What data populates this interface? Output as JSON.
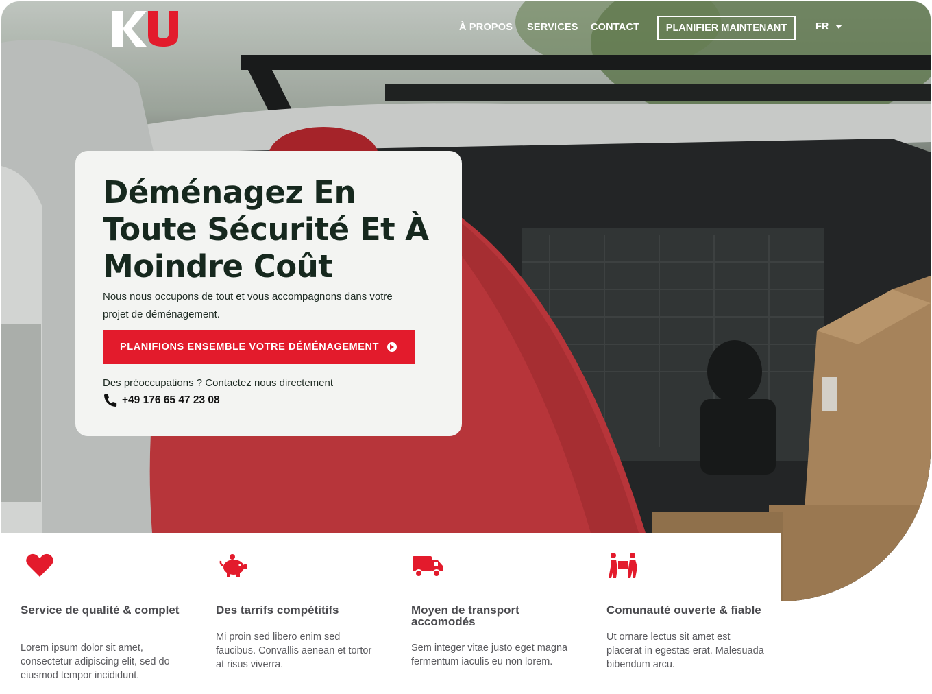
{
  "brand": {
    "logo_k": "K",
    "logo_u": "U",
    "accent": "#e31b2c",
    "dark": "#16281e"
  },
  "nav": {
    "items": [
      "À PROPOS",
      "SERVICES",
      "CONTACT"
    ],
    "cta": "PLANIFIER MAINTENANT",
    "language": "FR"
  },
  "hero": {
    "title": "Déménagez En Toute Sécurité Et À Moindre Coût",
    "subtitle": "Nous nous occupons de tout et vous accompagnons dans votre projet de déménagement.",
    "cta_label": "PLANIFIONS ENSEMBLE VOTRE DÉMÉNAGEMENT",
    "concern_text": "Des préoccupations ? Contactez nous directement",
    "phone": "+49 176 65 47 23 08"
  },
  "features": [
    {
      "icon": "heart-icon",
      "title": "Service de qualité & complet",
      "text": "Lorem ipsum dolor sit amet, consectetur adipiscing elit, sed do eiusmod tempor incididunt."
    },
    {
      "icon": "piggy-bank-icon",
      "title": "Des tarrifs compétitifs",
      "text": "Mi proin sed libero enim sed faucibus. Convallis aenean et tortor at risus viverra."
    },
    {
      "icon": "truck-icon",
      "title": "Moyen de transport accomodés",
      "text": "Sem integer vitae justo eget magna fermentum iaculis eu non lorem."
    },
    {
      "icon": "people-carry-icon",
      "title": "Comunauté ouverte & fiable",
      "text": "Ut ornare lectus sit amet est placerat in egestas erat. Malesuada bibendum arcu."
    }
  ]
}
